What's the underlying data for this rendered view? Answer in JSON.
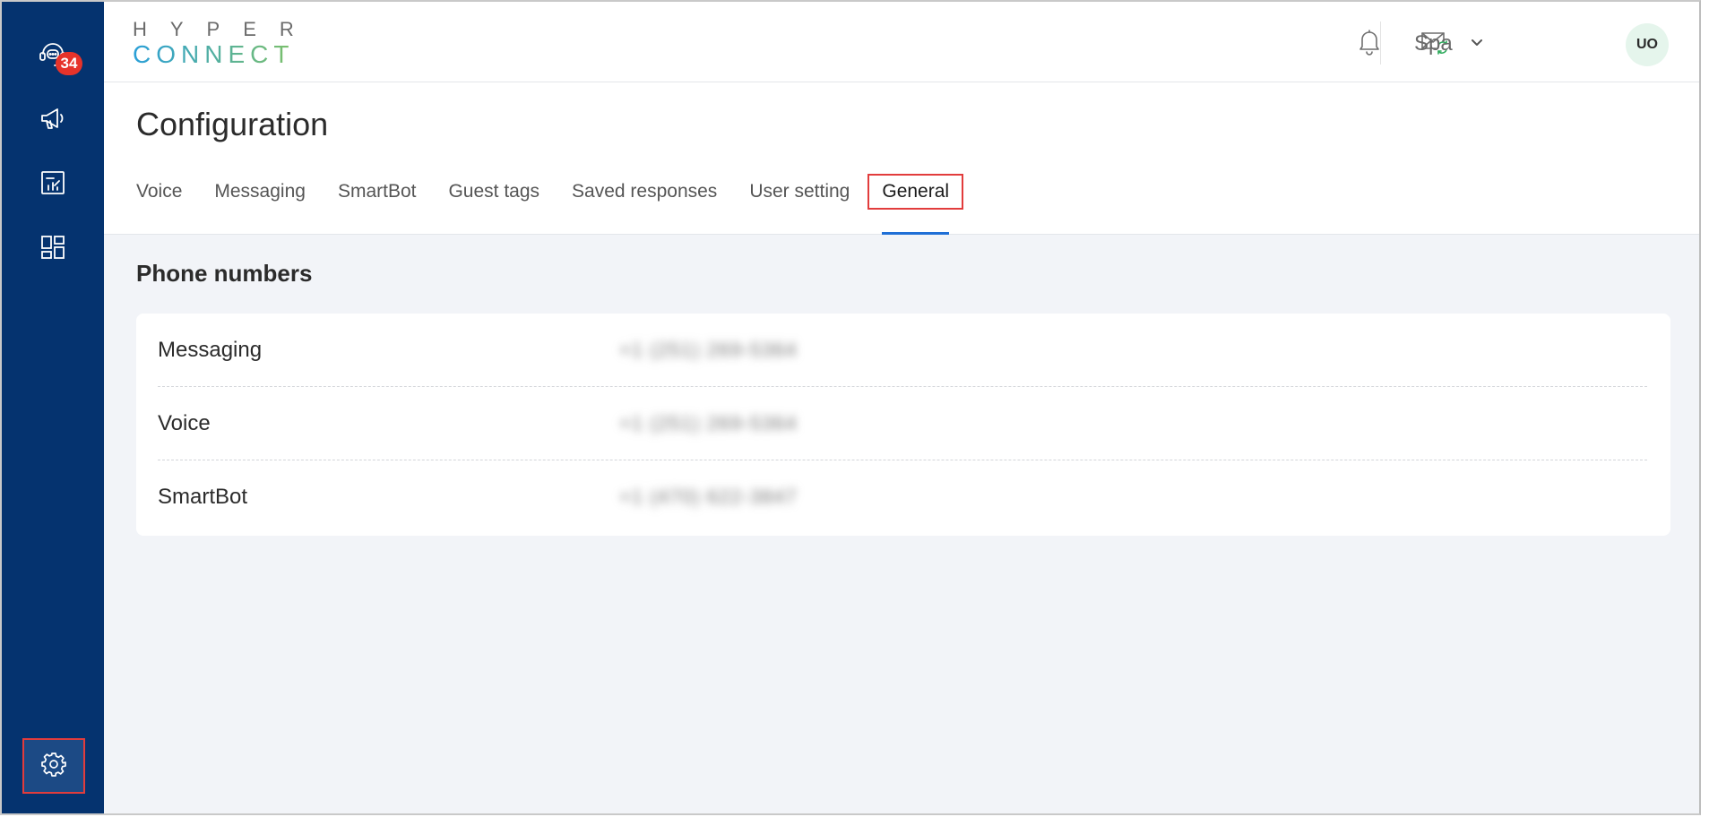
{
  "sidebar": {
    "badge_count": "34",
    "items": [
      {
        "name": "inbox",
        "icon": "headset-chat-icon"
      },
      {
        "name": "campaigns",
        "icon": "megaphone-icon"
      },
      {
        "name": "reports",
        "icon": "chart-report-icon"
      },
      {
        "name": "apps",
        "icon": "dashboard-grid-icon"
      }
    ],
    "settings_icon": "gear-icon"
  },
  "header": {
    "logo_top": "HYPER",
    "logo_bottom": "CONNECT",
    "org_selected": "Spa",
    "avatar_initials": "UO"
  },
  "page": {
    "title": "Configuration",
    "tabs": [
      {
        "label": "Voice",
        "active": false
      },
      {
        "label": "Messaging",
        "active": false
      },
      {
        "label": "SmartBot",
        "active": false
      },
      {
        "label": "Guest tags",
        "active": false
      },
      {
        "label": "Saved responses",
        "active": false
      },
      {
        "label": "User setting",
        "active": false
      },
      {
        "label": "General",
        "active": true
      }
    ]
  },
  "content": {
    "section_title": "Phone numbers",
    "rows": [
      {
        "label": "Messaging",
        "value": "+1 (251) 269-5364"
      },
      {
        "label": "Voice",
        "value": "+1 (251) 269-5364"
      },
      {
        "label": "SmartBot",
        "value": "+1 (470) 622-3847"
      }
    ]
  },
  "colors": {
    "sidebar_bg": "#05336f",
    "badge": "#e6332a",
    "highlight_border": "#e23c3c",
    "active_tab_underline": "#1f6fd6",
    "content_bg": "#f2f4f8"
  }
}
